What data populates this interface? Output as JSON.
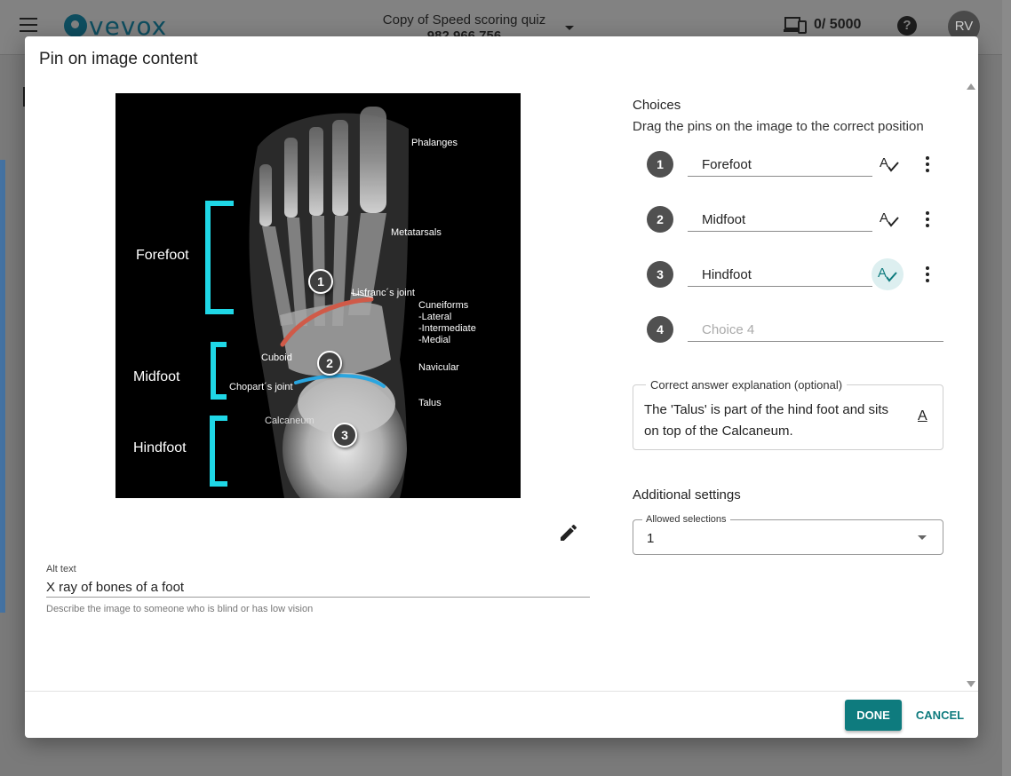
{
  "app": {
    "logo_text": "vevox",
    "session_title": "Copy of Speed scoring quiz",
    "session_id": "982 966 756",
    "participants": "0/ 5000",
    "help": "?",
    "avatar_initials": "RV"
  },
  "dialog": {
    "title": "Pin on image content",
    "image": {
      "labels": {
        "phalanges": "Phalanges",
        "metatarsals": "Metatarsals",
        "lisfranc": "Lisfranc´s joint",
        "cuneiforms": "Cuneiforms",
        "lateral": "-Lateral",
        "intermediate": "-Intermediate",
        "medial": "-Medial",
        "navicular": "Navicular",
        "talus": "Talus",
        "cuboid": "Cuboid",
        "chopart": "Chopart´s joint",
        "calcaneum": "Calcaneum",
        "forefoot": "Forefoot",
        "midfoot": "Midfoot",
        "hindfoot": "Hindfoot"
      },
      "pins": [
        "1",
        "2",
        "3"
      ]
    },
    "alt_text": {
      "label": "Alt text",
      "value": "X ray of bones of a foot",
      "help": "Describe the image to someone who is blind or has low vision"
    },
    "choices": {
      "title": "Choices",
      "subtitle": "Drag the pins on the image to the correct position",
      "items": [
        {
          "number": "1",
          "value": "Forefoot",
          "placeholder": ""
        },
        {
          "number": "2",
          "value": "Midfoot",
          "placeholder": ""
        },
        {
          "number": "3",
          "value": "Hindfoot",
          "placeholder": ""
        },
        {
          "number": "4",
          "value": "",
          "placeholder": "Choice 4"
        }
      ]
    },
    "explanation": {
      "label": "Correct answer explanation (optional)",
      "text": "The 'Talus' is part of the hind foot and sits on top of the Calcaneum."
    },
    "additional_settings": {
      "title": "Additional settings",
      "allowed_selections_label": "Allowed selections",
      "allowed_selections_value": "1"
    },
    "buttons": {
      "done": "DONE",
      "cancel": "CANCEL"
    }
  },
  "colors": {
    "accent": "#0e7b7e",
    "pin": "#3f3f3f",
    "bracket": "#1fd7e6",
    "lisfranc_line": "#d05a48",
    "chopart_line": "#2aa6e0"
  }
}
